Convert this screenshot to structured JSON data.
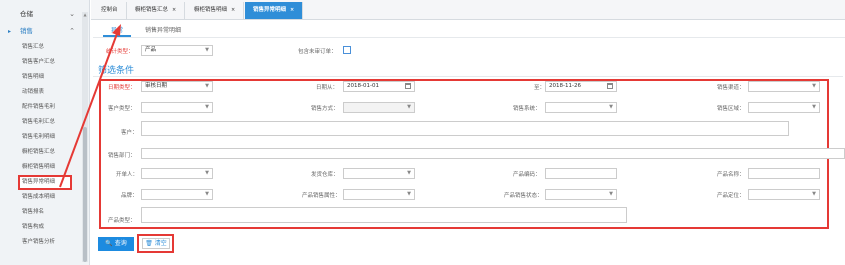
{
  "sidebar": {
    "top_partial": "",
    "groups": [
      {
        "label": "仓储"
      },
      {
        "label": "销售"
      }
    ],
    "items": [
      {
        "label": "销售汇总"
      },
      {
        "label": "销售客户汇总"
      },
      {
        "label": "销售明细"
      },
      {
        "label": "动销报表"
      },
      {
        "label": "配件销售毛利"
      },
      {
        "label": "销售毛利汇总"
      },
      {
        "label": "销售毛利明细"
      },
      {
        "label": "橱柜销售汇总"
      },
      {
        "label": "橱柜销售明细"
      },
      {
        "label": "销售异常明细"
      },
      {
        "label": "销售成本明细"
      },
      {
        "label": "销售排名"
      },
      {
        "label": "销售构成"
      },
      {
        "label": "客户销售分析"
      }
    ]
  },
  "tabs": [
    {
      "label": "控制台",
      "close": ""
    },
    {
      "label": "橱柜销售汇总",
      "close": "×"
    },
    {
      "label": "橱柜销售明细",
      "close": "×"
    },
    {
      "label": "销售异常明细",
      "close": "×"
    }
  ],
  "subtabs": [
    {
      "label": "异常"
    },
    {
      "label": "销售异常明细"
    }
  ],
  "stats": {
    "type_label": "统计类型：",
    "type_value": "产品",
    "include_unreviewed_label": "包含未审订单："
  },
  "filter": {
    "title": "筛选条件",
    "date_type_label": "日期类型：",
    "date_type_value": "审核日期",
    "date_from_label": "日期从：",
    "date_from_value": "2018-01-01",
    "date_to_label": "至：",
    "date_to_value": "2018-11-26",
    "sales_channel_label": "销售渠道：",
    "customer_type_label": "客户类型：",
    "sales_method_label": "销售方式：",
    "sales_system_label": "销售系统：",
    "sales_region_label": "销售区域：",
    "customer_label": "客户：",
    "sales_dept_label": "销售部门：",
    "creator_label": "开单人：",
    "warehouse_label": "发货仓库：",
    "product_code_label": "产品编码：",
    "product_name_label": "产品名称：",
    "brand_label": "品牌：",
    "product_sale_attr_label": "产品销售属性：",
    "product_sale_status_label": "产品销售状态：",
    "product_position_label": "产品定位：",
    "product_type_label": "产品类型："
  },
  "buttons": {
    "query": "查询",
    "clear": "清空"
  },
  "colors": {
    "accent": "#2f8ed8",
    "highlight": "#e53935"
  }
}
